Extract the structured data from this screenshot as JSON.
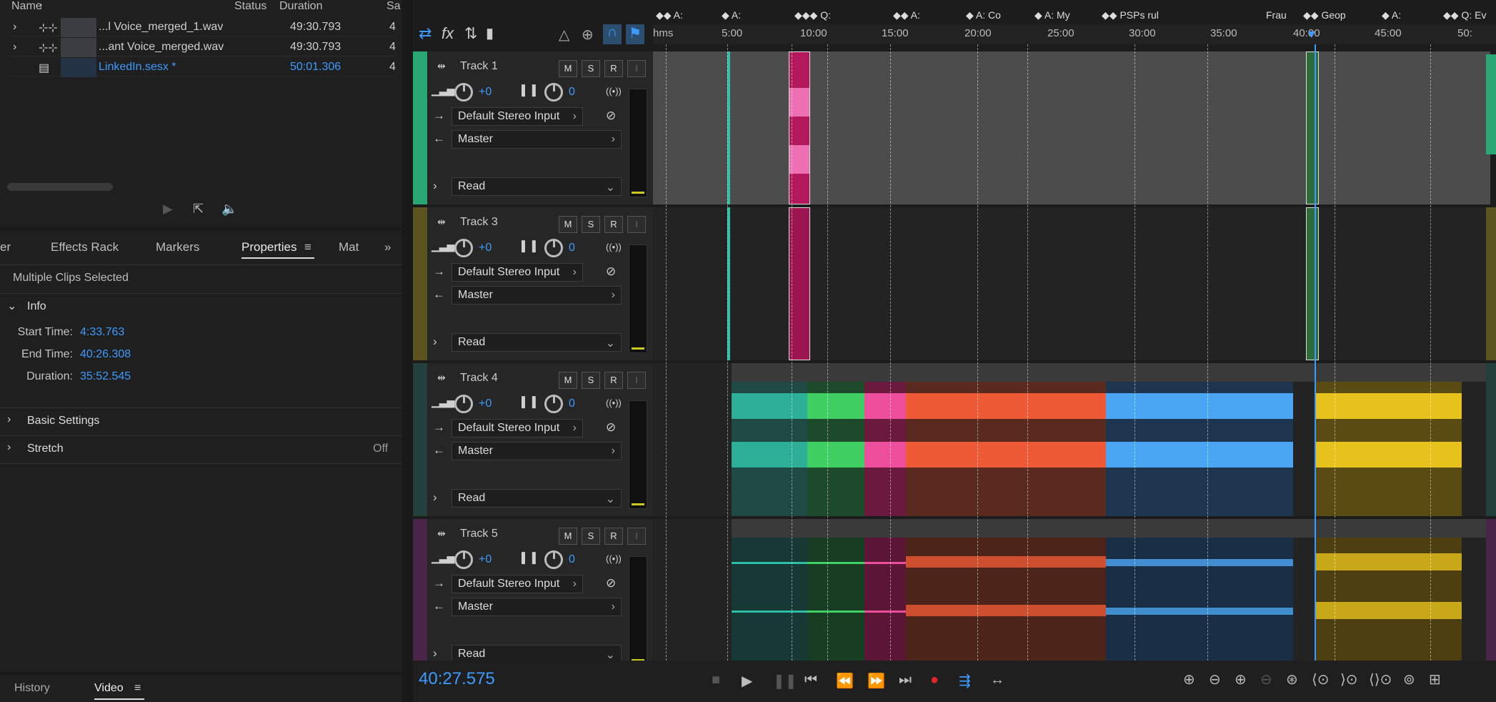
{
  "files_panel": {
    "columns": [
      "Name",
      "Status",
      "Duration",
      "Sa"
    ],
    "rows": [
      {
        "name": "...l Voice_merged_1.wav",
        "duration": "49:30.793",
        "rate": "4"
      },
      {
        "name": "...ant Voice_merged.wav",
        "duration": "49:30.793",
        "rate": "4"
      },
      {
        "name": "LinkedIn.sesx *",
        "duration": "50:01.306",
        "rate": "4"
      }
    ]
  },
  "props_panel": {
    "tabs": [
      "er",
      "Effects Rack",
      "Markers",
      "Properties",
      "Mat"
    ],
    "active_tab": "Properties",
    "selection_label": "Multiple Clips Selected",
    "info_section": "Info",
    "start_label": "Start Time:",
    "start_value": "4:33.763",
    "end_label": "End Time:",
    "end_value": "40:26.308",
    "duration_label": "Duration:",
    "duration_value": "35:52.545",
    "basic_settings": "Basic Settings",
    "stretch": "Stretch",
    "stretch_value": "Off"
  },
  "bottom_tabs": {
    "history": "History",
    "video": "Video"
  },
  "ruler": {
    "labels": [
      "hms",
      "5:00",
      "10:00",
      "15:00",
      "20:00",
      "25:00",
      "30:00",
      "35:00",
      "40:00",
      "45:00",
      "50:"
    ]
  },
  "markers": [
    "A:",
    "A:",
    "Q:",
    "A:",
    "A: Co",
    "A: My",
    "PSPs rul",
    "Frau",
    "Geop",
    "A:",
    "Q: Ev"
  ],
  "tracks": [
    {
      "name": "Track 1",
      "color": "#2aa775",
      "vol": "+0",
      "pan": "0",
      "input": "Default Stereo Input",
      "output": "Master",
      "mode": "Read"
    },
    {
      "name": "Track 3",
      "color": "#5b5420",
      "vol": "+0",
      "pan": "0",
      "input": "Default Stereo Input",
      "output": "Master",
      "mode": "Read"
    },
    {
      "name": "Track 4",
      "color": "#24403c",
      "vol": "+0",
      "pan": "0",
      "input": "Default Stereo Input",
      "output": "Master",
      "mode": "Read"
    },
    {
      "name": "Track 5",
      "color": "#4a2549",
      "vol": "+0",
      "pan": "0",
      "input": "Default Stereo Input",
      "output": "Master",
      "mode": "Read"
    }
  ],
  "track_buttons": {
    "m": "M",
    "s": "S",
    "r": "R",
    "i": "I"
  },
  "transport": {
    "time": "40:27.575"
  },
  "colors": {
    "accent": "#3d9bff",
    "clip_teal": "#2fbfa6",
    "clip_green": "#3fcf62",
    "clip_pink": "#ee4f9c",
    "clip_orange": "#ef5a36",
    "clip_blue": "#4aa6f2",
    "clip_yellow": "#e7c21c",
    "record": "#e02626"
  }
}
